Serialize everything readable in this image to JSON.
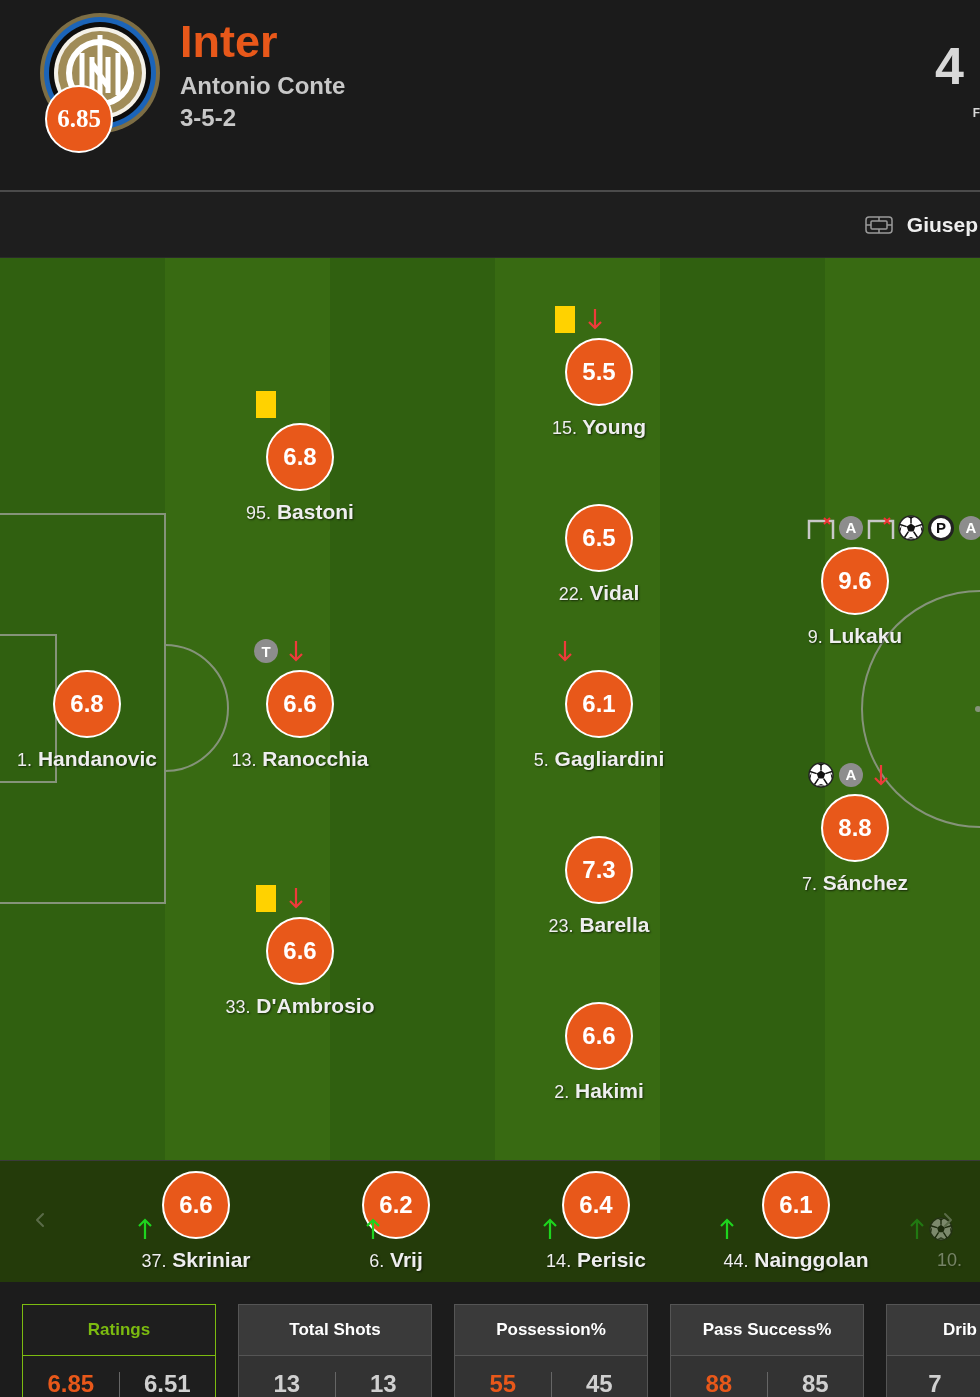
{
  "header": {
    "team_name": "Inter",
    "manager": "Antonio Conte",
    "formation": "3-5-2",
    "team_rating": "6.85",
    "score": "4",
    "score_caption": "F"
  },
  "venue": {
    "name": "Giusep"
  },
  "pitch": {
    "lines": [
      {
        "players": [
          {
            "number": "1.",
            "name": "Handanovic",
            "rating": "6.8"
          }
        ]
      },
      {
        "players": [
          {
            "number": "95.",
            "name": "Bastoni",
            "rating": "6.8",
            "events": [
              {
                "kind": "yellow_card"
              }
            ]
          },
          {
            "number": "13.",
            "name": "Ranocchia",
            "rating": "6.6",
            "events": [
              {
                "kind": "badge",
                "text": "T"
              },
              {
                "kind": "sub_off"
              }
            ]
          },
          {
            "number": "33.",
            "name": "D'Ambrosio",
            "rating": "6.6",
            "events": [
              {
                "kind": "yellow_card"
              },
              {
                "kind": "sub_off"
              }
            ]
          }
        ]
      },
      {
        "players": [
          {
            "number": "15.",
            "name": "Young",
            "rating": "5.5",
            "events": [
              {
                "kind": "yellow_card"
              },
              {
                "kind": "sub_off"
              }
            ]
          },
          {
            "number": "22.",
            "name": "Vidal",
            "rating": "6.5"
          },
          {
            "number": "5.",
            "name": "Gagliardini",
            "rating": "6.1",
            "events": [
              {
                "kind": "sub_off"
              }
            ]
          },
          {
            "number": "23.",
            "name": "Barella",
            "rating": "7.3"
          },
          {
            "number": "2.",
            "name": "Hakimi",
            "rating": "6.6"
          }
        ]
      },
      {
        "players": [
          {
            "number": "9.",
            "name": "Lukaku",
            "rating": "9.6",
            "events": [
              {
                "kind": "miss"
              },
              {
                "kind": "badge",
                "text": "A"
              },
              {
                "kind": "miss"
              },
              {
                "kind": "goal"
              },
              {
                "kind": "penalty_goal",
                "text": "P"
              },
              {
                "kind": "badge",
                "text": "A"
              }
            ]
          },
          {
            "number": "7.",
            "name": "Sánchez",
            "rating": "8.8",
            "events": [
              {
                "kind": "goal"
              },
              {
                "kind": "badge",
                "text": "A"
              },
              {
                "kind": "sub_off"
              }
            ]
          }
        ]
      }
    ]
  },
  "substitutes": {
    "players": [
      {
        "number": "37.",
        "name": "Skriniar",
        "rating": "6.6",
        "dimmed": false,
        "events": [
          {
            "kind": "sub_on"
          }
        ]
      },
      {
        "number": "6.",
        "name": "Vrij",
        "rating": "6.2",
        "dimmed": false,
        "events": [
          {
            "kind": "sub_on"
          }
        ]
      },
      {
        "number": "14.",
        "name": "Perisic",
        "rating": "6.4",
        "dimmed": false,
        "events": [
          {
            "kind": "sub_on"
          }
        ]
      },
      {
        "number": "44.",
        "name": "Nainggolan",
        "rating": "6.1",
        "dimmed": false,
        "events": [
          {
            "kind": "sub_on"
          }
        ]
      },
      {
        "number": "10.",
        "dimmed": true,
        "events": [
          {
            "kind": "sub_on"
          },
          {
            "kind": "goal"
          }
        ]
      }
    ]
  },
  "stats": {
    "cards": [
      {
        "title": "Ratings",
        "selected": true,
        "values": [
          {
            "text": "6.85",
            "highlighted": true
          },
          {
            "text": "6.51",
            "highlighted": false
          }
        ]
      },
      {
        "title": "Total Shots",
        "selected": false,
        "values": [
          {
            "text": "13",
            "highlighted": false
          },
          {
            "text": "13",
            "highlighted": false
          }
        ]
      },
      {
        "title": "Possession%",
        "selected": false,
        "values": [
          {
            "text": "55",
            "highlighted": true
          },
          {
            "text": "45",
            "highlighted": false
          }
        ]
      },
      {
        "title": "Pass Success%",
        "selected": false,
        "values": [
          {
            "text": "88",
            "highlighted": true
          },
          {
            "text": "85",
            "highlighted": false
          }
        ]
      },
      {
        "title": "Drib",
        "selected": false,
        "values": [
          {
            "text": "7",
            "highlighted": false
          }
        ]
      }
    ]
  }
}
